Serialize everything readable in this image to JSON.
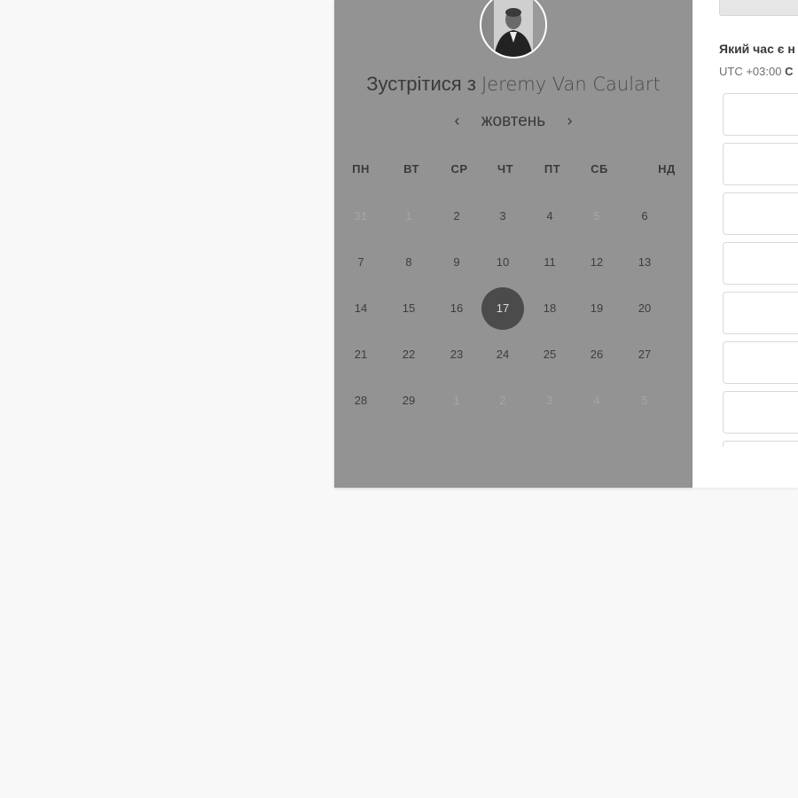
{
  "scheduler": {
    "title_prefix": "Зустрітися з",
    "host_name": "Jeremy Van Caulart",
    "month": "жовтень",
    "prev_arrow": "‹",
    "next_arrow": "›",
    "weekdays": [
      "ПН",
      "ВТ",
      "СР",
      "ЧТ",
      "ПТ",
      "СБ",
      "НД"
    ],
    "weeks": [
      [
        {
          "d": "31",
          "muted": true
        },
        {
          "d": "1",
          "muted": true
        },
        {
          "d": "2"
        },
        {
          "d": "3"
        },
        {
          "d": "4"
        },
        {
          "d": "5",
          "muted": true
        },
        {
          "d": "6"
        }
      ],
      [
        {
          "d": "7"
        },
        {
          "d": "8"
        },
        {
          "d": "9"
        },
        {
          "d": "10"
        },
        {
          "d": "11"
        },
        {
          "d": "12"
        },
        {
          "d": "13"
        }
      ],
      [
        {
          "d": "14"
        },
        {
          "d": "15"
        },
        {
          "d": "16"
        },
        {
          "d": "17",
          "selected": true
        },
        {
          "d": "18"
        },
        {
          "d": "19"
        },
        {
          "d": "20"
        }
      ],
      [
        {
          "d": "21"
        },
        {
          "d": "22"
        },
        {
          "d": "23"
        },
        {
          "d": "24"
        },
        {
          "d": "25"
        },
        {
          "d": "26"
        },
        {
          "d": "27"
        }
      ],
      [
        {
          "d": "28"
        },
        {
          "d": "29"
        },
        {
          "d": "1",
          "muted": true
        },
        {
          "d": "2",
          "muted": true
        },
        {
          "d": "3",
          "muted": true
        },
        {
          "d": "4",
          "muted": true
        },
        {
          "d": "5",
          "muted": true
        }
      ]
    ],
    "selected_day": "17"
  },
  "time_panel": {
    "question": "Який час є н",
    "timezone_prefix": "UTC +03:00",
    "timezone_suffix": "С",
    "slot_count": 8
  },
  "colors": {
    "page_bg": "#f8f8f8",
    "calendar_panel_bg": "#939393",
    "selected_day_bg": "#4b4b4b",
    "time_panel_bg": "#ffffff"
  }
}
